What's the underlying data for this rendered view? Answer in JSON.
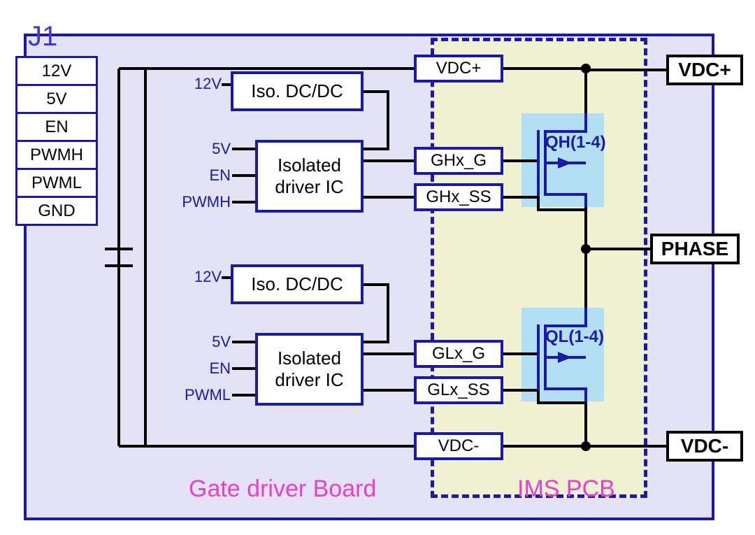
{
  "j1": {
    "title": "J1",
    "pins": [
      "12V",
      "5V",
      "EN",
      "PWMH",
      "PWML",
      "GND"
    ]
  },
  "high_side": {
    "dcdc": "Iso. DC/DC",
    "dcdc_in": "12V",
    "driver": "Isolated\ndriver IC",
    "in1": "5V",
    "in2": "EN",
    "in3": "PWMH",
    "out_g": "GHx_G",
    "out_ss": "GHx_SS",
    "fet": "QH(1-4)"
  },
  "low_side": {
    "dcdc": "Iso. DC/DC",
    "dcdc_in": "12V",
    "driver": "Isolated\ndriver IC",
    "in1": "5V",
    "in2": "EN",
    "in3": "PWML",
    "out_g": "GLx_G",
    "out_ss": "GLx_SS",
    "fet": "QL(1-4)"
  },
  "rails": {
    "vdc_plus_int": "VDC+",
    "vdc_minus_int": "VDC-",
    "vdc_plus_ext": "VDC+",
    "vdc_minus_ext": "VDC-",
    "phase": "PHASE"
  },
  "regions": {
    "board": "Gate driver Board",
    "ims": "IMS PCB"
  }
}
